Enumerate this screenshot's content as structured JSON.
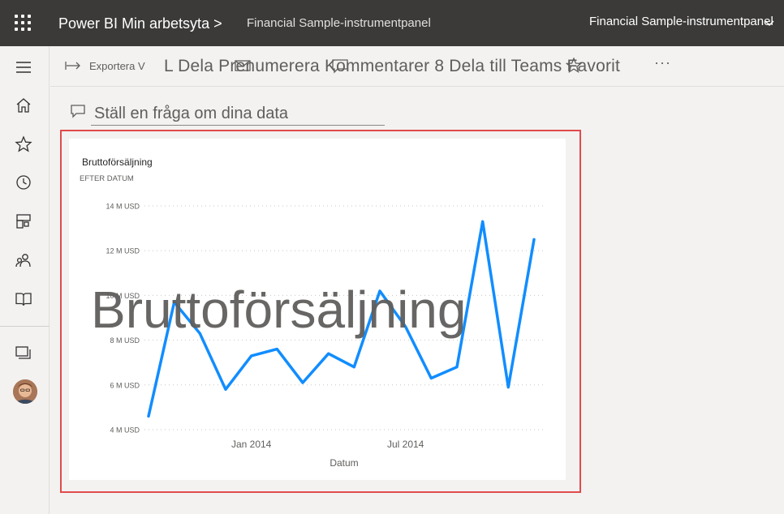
{
  "header": {
    "app_title": "Power BI Min arbetsyta >",
    "report_name": "Financial Sample-instrumentpanel",
    "report_name_right": "Financial Sample-instrumentpanel",
    "icons": [
      "waffle-icon",
      "chevron-down-icon"
    ]
  },
  "leftnav": {
    "icons": [
      "hamburger-icon",
      "home-icon",
      "star-icon",
      "clock-icon",
      "apps-icon",
      "people-icon",
      "book-icon",
      "workspaces-icon",
      "avatar"
    ]
  },
  "toolbar": {
    "export_label": "Exportera V",
    "actions_label": "L Dela Prenumerera Kommentarer 8 Dela till Teams Favorit",
    "more_label": "···"
  },
  "qna": {
    "placeholder": "Ställ en fråga om dina data"
  },
  "tile": {
    "title": "Bruttoförsäljning",
    "subtitle": "EFTER DATUM",
    "overlay_title": "Bruttoförsäljning"
  },
  "chart_data": {
    "type": "line",
    "title": "Bruttoförsäljning",
    "subtitle": "EFTER DATUM",
    "xlabel": "Datum",
    "ylabel": "",
    "x_tick_labels": [
      "Jan 2014",
      "Jul 2014"
    ],
    "y_tick_labels": [
      "14 M USD",
      "12 M USD",
      "10 M USD",
      "8 M USD",
      "6 M USD",
      "4 M USD"
    ],
    "y_ticks": [
      14,
      12,
      10,
      8,
      6,
      4
    ],
    "ylim": [
      4,
      14
    ],
    "grid": true,
    "color": "#118dff",
    "x": [
      "2013-09",
      "2013-10",
      "2013-11",
      "2013-12",
      "2014-01",
      "2014-02",
      "2014-03",
      "2014-04",
      "2014-05",
      "2014-06",
      "2014-07",
      "2014-08",
      "2014-09",
      "2014-10",
      "2014-11",
      "2014-12"
    ],
    "series": [
      {
        "values": [
          4.6,
          9.7,
          8.3,
          5.8,
          7.3,
          7.6,
          6.1,
          7.4,
          6.8,
          10.2,
          8.6,
          6.3,
          6.8,
          13.3,
          5.9,
          12.5
        ]
      }
    ]
  }
}
